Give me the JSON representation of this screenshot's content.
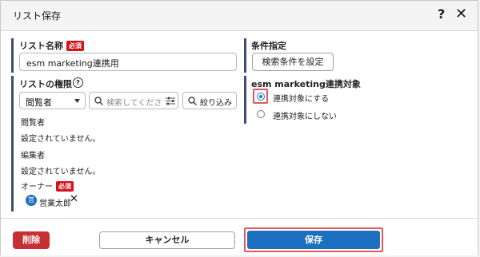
{
  "dialog": {
    "title": "リスト保存",
    "help_glyph": "?",
    "close_glyph": "✕"
  },
  "list_name": {
    "label": "リスト名称",
    "required": "必須",
    "value": "esm marketing連携用"
  },
  "permissions": {
    "label": "リストの権限",
    "role_select": "閲覧者",
    "search_placeholder": "検索してくださ",
    "filter_button": "絞り込み",
    "viewer_label": "閲覧者",
    "viewer_value": "設定されていません。",
    "editor_label": "編集者",
    "editor_value": "設定されていません。",
    "owner_label": "オーナー",
    "owner_required": "必須",
    "owner_avatar": "営",
    "owner_name": "営業太郎"
  },
  "conditions": {
    "label": "条件指定",
    "button": "検索条件を設定"
  },
  "esm": {
    "label": "esm marketing連携対象",
    "option_on": "連携対象にする",
    "option_off": "連携対象にしない",
    "selected": "連携対象にする"
  },
  "footer": {
    "delete": "削除",
    "cancel": "キャンセル",
    "save": "保存"
  },
  "colors": {
    "delete": "#c62f34",
    "save": "#1d6fbf",
    "required": "#d0121b",
    "highlight": "#e2575d",
    "avatar": "#1d6fbf"
  }
}
